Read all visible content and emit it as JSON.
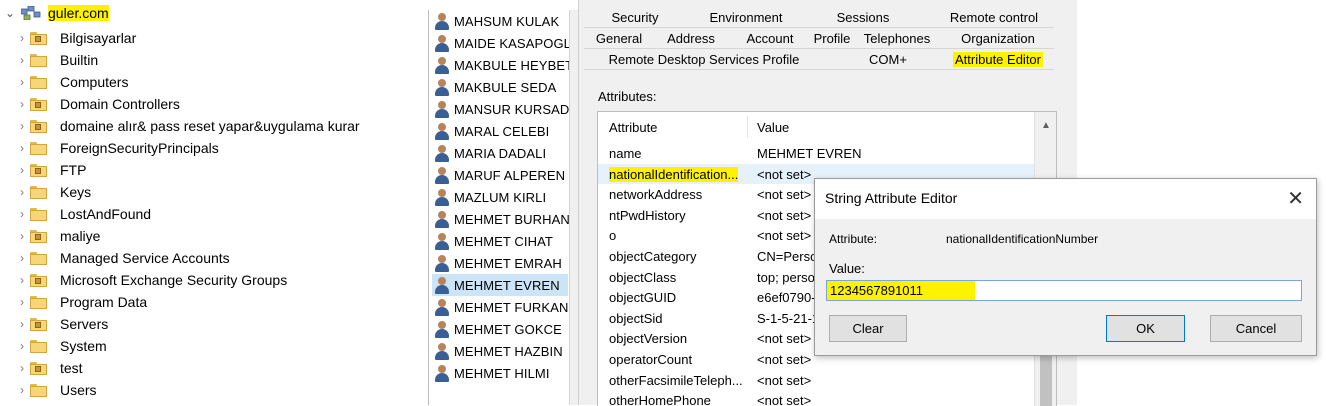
{
  "tree": {
    "root_label": "guler.com",
    "items": [
      {
        "label": "Bilgisayarlar",
        "type": "ou"
      },
      {
        "label": "Builtin",
        "type": "folder"
      },
      {
        "label": "Computers",
        "type": "folder"
      },
      {
        "label": "Domain Controllers",
        "type": "ou"
      },
      {
        "label": "domaine alır& pass reset yapar&uygulama kurar",
        "type": "ou"
      },
      {
        "label": "ForeignSecurityPrincipals",
        "type": "folder"
      },
      {
        "label": "FTP",
        "type": "ou"
      },
      {
        "label": "Keys",
        "type": "folder"
      },
      {
        "label": "LostAndFound",
        "type": "folder"
      },
      {
        "label": "maliye",
        "type": "ou"
      },
      {
        "label": "Managed Service Accounts",
        "type": "folder"
      },
      {
        "label": "Microsoft Exchange Security Groups",
        "type": "ou"
      },
      {
        "label": "Program Data",
        "type": "folder"
      },
      {
        "label": "Servers",
        "type": "ou"
      },
      {
        "label": "System",
        "type": "folder"
      },
      {
        "label": "test",
        "type": "ou"
      },
      {
        "label": "Users",
        "type": "folder"
      }
    ]
  },
  "users": [
    "MAHSUM KULAK",
    "MAIDE KASAPOGL",
    "MAKBULE HEYBET",
    "MAKBULE SEDA",
    "MANSUR KURSAD",
    "MARAL CELEBI",
    "MARIA DADALI",
    "MARUF ALPEREN",
    "MAZLUM KIRLI",
    "MEHMET BURHAN",
    "MEHMET CIHAT",
    "MEHMET EMRAH",
    "MEHMET EVREN",
    "MEHMET FURKAN",
    "MEHMET GOKCE",
    "MEHMET HAZBIN",
    "MEHMET HILMI"
  ],
  "selected_user": "MEHMET EVREN",
  "properties": {
    "tabs_row1": [
      "Security",
      "Environment",
      "Sessions",
      "Remote control"
    ],
    "tabs_row2": [
      "General",
      "Address",
      "Account",
      "Profile",
      "Telephones",
      "Organization"
    ],
    "tabs_row3": [
      "Remote Desktop Services Profile",
      "COM+",
      "Attribute Editor"
    ],
    "active_tab": "Attribute Editor",
    "attributes_label": "Attributes:",
    "col_attribute": "Attribute",
    "col_value": "Value",
    "rows": [
      {
        "name": "name",
        "value": "MEHMET EVREN"
      },
      {
        "name": "nationalIdentification...",
        "value": "<not set>"
      },
      {
        "name": "networkAddress",
        "value": "<not set>"
      },
      {
        "name": "ntPwdHistory",
        "value": "<not set>"
      },
      {
        "name": "o",
        "value": "<not set>"
      },
      {
        "name": "objectCategory",
        "value": "CN=Perso"
      },
      {
        "name": "objectClass",
        "value": "top; perso"
      },
      {
        "name": "objectGUID",
        "value": "e6ef0790-"
      },
      {
        "name": "objectSid",
        "value": "S-1-5-21-1"
      },
      {
        "name": "objectVersion",
        "value": "<not set>"
      },
      {
        "name": "operatorCount",
        "value": "<not set>"
      },
      {
        "name": "otherFacsimileTeleph...",
        "value": "<not set>"
      },
      {
        "name": "otherHomePhone",
        "value": "<not set>"
      }
    ],
    "selected_row": 1
  },
  "editor": {
    "title": "String Attribute Editor",
    "close_glyph": "✕",
    "attribute_label": "Attribute:",
    "attribute_value": "nationalIdentificationNumber",
    "value_label": "Value:",
    "value": "1234567891011",
    "clear_label": "Clear",
    "ok_label": "OK",
    "cancel_label": "Cancel"
  },
  "colors": {
    "highlight": "#fff200",
    "selection": "#cce4f7",
    "focus_border": "#0078d7"
  }
}
